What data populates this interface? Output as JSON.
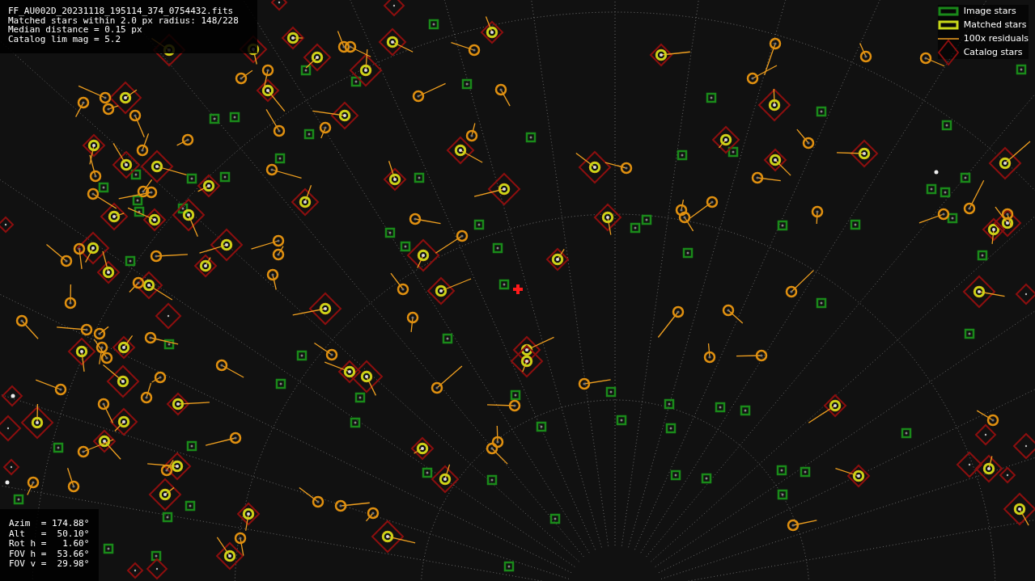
{
  "info": [
    "FF_AU002D_20231118_195114_374_0754432.fits",
    "Matched stars within 2.0 px radius: 148/228",
    "Median distance = 0.15 px",
    "Catalog lim mag = 5.2"
  ],
  "legend": [
    {
      "kind": "image",
      "label": "Image stars"
    },
    {
      "kind": "matched",
      "label": "Matched stars"
    },
    {
      "kind": "residual",
      "label": "100x residuals"
    },
    {
      "kind": "catalog",
      "label": "Catalog stars"
    }
  ],
  "pointing": [
    "Azim  = 174.88°",
    "Alt   =  50.10°",
    "Rot h =   1.60°",
    "FOV h =  53.66°",
    "FOV v =  29.98°"
  ]
}
